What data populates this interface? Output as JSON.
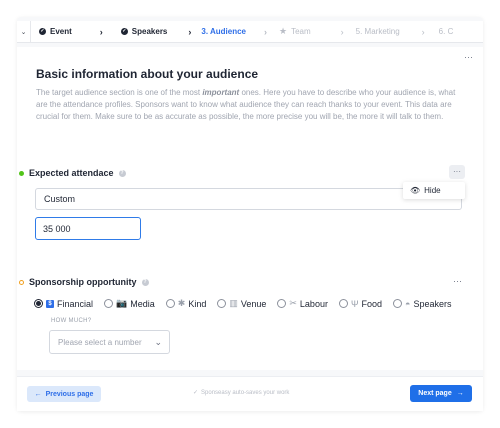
{
  "stepper": {
    "collapse_icon": "double-chevron-icon",
    "steps": [
      {
        "label": "Event",
        "state": "done"
      },
      {
        "label": "Speakers",
        "state": "done"
      },
      {
        "label": "3. Audience",
        "state": "active"
      },
      {
        "label": "Team",
        "state": "future"
      },
      {
        "label": "5. Marketing",
        "state": "future"
      },
      {
        "label": "6. C",
        "state": "future"
      }
    ]
  },
  "card": {
    "menu": "···",
    "title": "Basic information about your audience",
    "desc_1": "The target audience section is one of the most ",
    "desc_em": "important",
    "desc_2": " ones. Here you have to describe who your audience is, what are the attendance profiles. Sponsors want to know what audience they can reach thanks to your event. This data are crucial for them. Make sure to be as accurate as possible, the more precise you will be, the more it will talk to them."
  },
  "attendance": {
    "label": "Expected attendace",
    "help": "?",
    "more": "···",
    "hide_label": "Hide",
    "select_value": "Custom",
    "input_value": "35 000"
  },
  "sponsorship": {
    "label": "Sponsorship opportunity",
    "help": "?",
    "more": "···",
    "options": [
      {
        "label": "Financial",
        "icon": "$",
        "selected": true
      },
      {
        "label": "Media",
        "icon": "📷",
        "selected": false
      },
      {
        "label": "Kind",
        "icon": "✱",
        "selected": false
      },
      {
        "label": "Venue",
        "icon": "▥",
        "selected": false
      },
      {
        "label": "Labour",
        "icon": "✂",
        "selected": false
      },
      {
        "label": "Food",
        "icon": "Ψ",
        "selected": false
      },
      {
        "label": "Speakers",
        "icon": "◓",
        "selected": false
      }
    ],
    "how_much_label": "HOW MUCH?",
    "number_placeholder": "Please select a number"
  },
  "footer": {
    "prev_label": "Previous page",
    "autosave_text": "Sponseasy auto-saves your work",
    "next_label": "Next page"
  },
  "colors": {
    "accent": "#2f6fe8",
    "green_dot": "#52c41a",
    "orange_dot": "#f0a020"
  }
}
